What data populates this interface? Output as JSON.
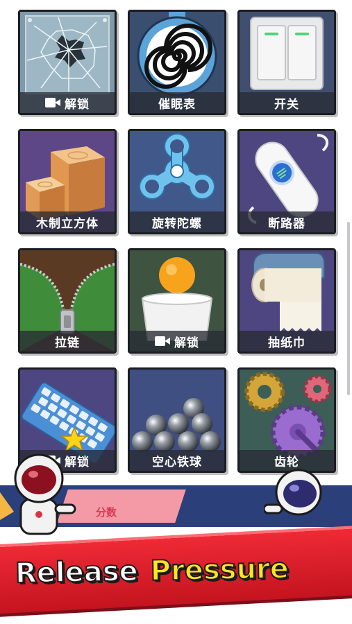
{
  "tiles": [
    {
      "id": "broken-glass",
      "label": "解锁",
      "locked": true
    },
    {
      "id": "hypnosis-watch",
      "label": "催眠表",
      "locked": false
    },
    {
      "id": "switch",
      "label": "开关",
      "locked": false
    },
    {
      "id": "wooden-cube",
      "label": "木制立方体",
      "locked": false
    },
    {
      "id": "fidget-spinner",
      "label": "旋转陀螺",
      "locked": false
    },
    {
      "id": "circuit-breaker",
      "label": "断路器",
      "locked": false
    },
    {
      "id": "zipper",
      "label": "拉链",
      "locked": false
    },
    {
      "id": "ping-pong-cup",
      "label": "解锁",
      "locked": true
    },
    {
      "id": "tissue-roll",
      "label": "抽纸巾",
      "locked": false
    },
    {
      "id": "keyboard",
      "label": "解锁",
      "locked": true
    },
    {
      "id": "hollow-iron-balls",
      "label": "空心铁球",
      "locked": false
    },
    {
      "id": "gears",
      "label": "齿轮",
      "locked": false
    }
  ],
  "banner": {
    "score_label": "分数",
    "slogan_part1": "Release",
    "slogan_part2": "Pressure"
  },
  "colors": {
    "tile_border": "#1b1d22",
    "label_bar": "#2c3038",
    "banner_red": "#e3202c",
    "slogan_yellow": "#ffe51f",
    "navy": "#2b3f7a"
  }
}
